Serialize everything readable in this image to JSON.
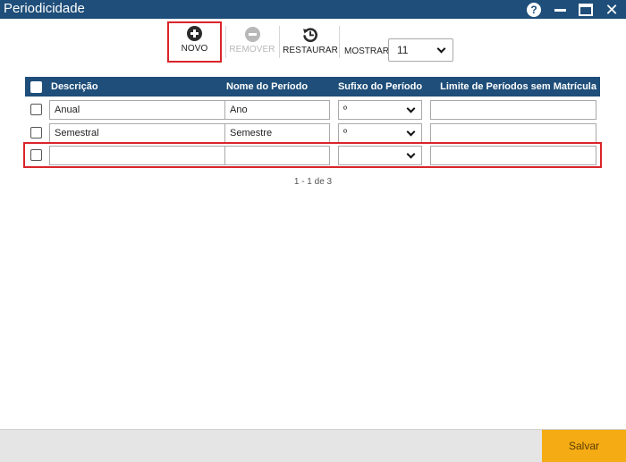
{
  "window": {
    "title": "Periodicidade",
    "help_glyph": "?",
    "close_glyph": "✕"
  },
  "toolbar": {
    "novo_label": "NOVO",
    "remover_label": "REMOVER",
    "restaurar_label": "RESTAURAR",
    "mostrar_label": "MOSTRAR:",
    "mostrar_value": "11"
  },
  "table": {
    "columns": {
      "descricao": "Descrição",
      "nome_periodo": "Nome do Período",
      "sufixo_periodo": "Sufixo do Período",
      "limite_periodos": "Limite de Períodos sem Matrícula"
    },
    "rows": [
      {
        "descricao": "Anual",
        "nome_periodo": "Ano",
        "sufixo_periodo": "º",
        "limite_periodos": ""
      },
      {
        "descricao": "Semestral",
        "nome_periodo": "Semestre",
        "sufixo_periodo": "º",
        "limite_periodos": ""
      },
      {
        "descricao": "",
        "nome_periodo": "",
        "sufixo_periodo": "",
        "limite_periodos": ""
      }
    ]
  },
  "pager": {
    "text": "1 - 1 de 3"
  },
  "footer": {
    "save_label": "Salvar"
  },
  "colors": {
    "titlebar": "#1e4e79",
    "header": "#1e4e79",
    "highlight": "#d9252a",
    "save_button": "#f4ab14",
    "footer": "#e5e5e5"
  },
  "icons": {
    "help": "help-icon",
    "minimize": "minimize-icon",
    "maximize": "maximize-icon",
    "close": "close-icon",
    "novo": "plus-circle-icon",
    "remover": "minus-circle-icon",
    "restaurar": "history-icon",
    "dropdown": "chevron-down-icon"
  }
}
